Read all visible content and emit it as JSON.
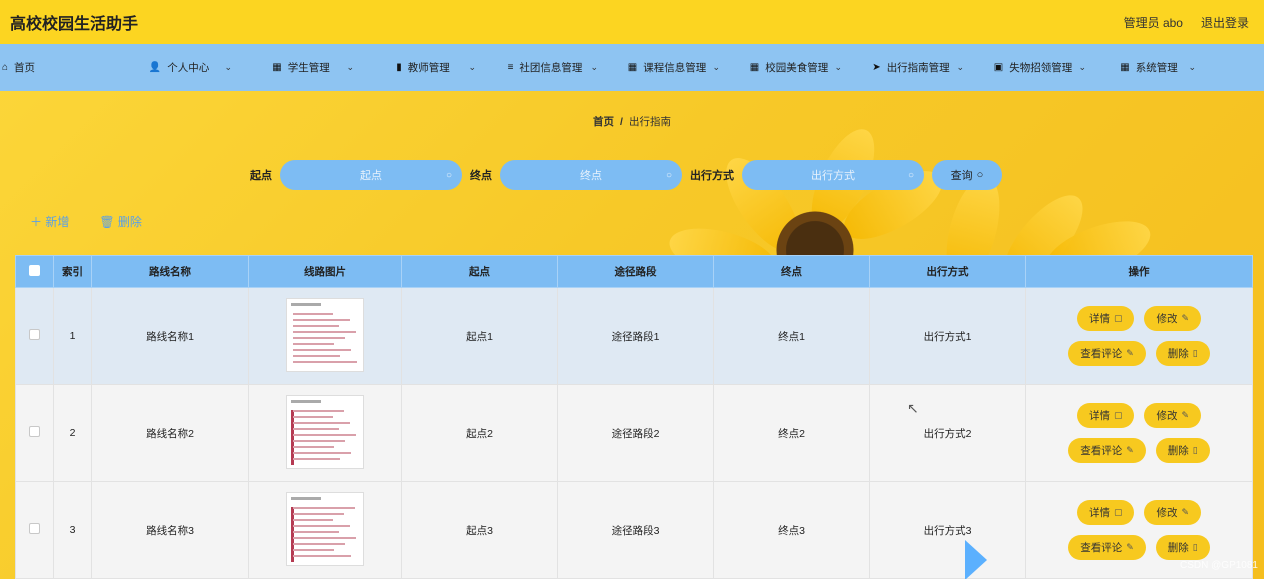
{
  "header": {
    "title": "高校校园生活助手",
    "user": "管理员 abo",
    "logout": "退出登录"
  },
  "nav": [
    {
      "label": "首页",
      "icon": "home-icon",
      "glyph": "⌂",
      "chevron": false
    },
    {
      "label": "个人中心",
      "icon": "user-icon",
      "glyph": "👤",
      "chevron": true
    },
    {
      "label": "学生管理",
      "icon": "grid-icon",
      "glyph": "▦",
      "chevron": true
    },
    {
      "label": "教师管理",
      "icon": "bar-chart-icon",
      "glyph": "▮",
      "chevron": true
    },
    {
      "label": "社团信息管理",
      "icon": "list-icon",
      "glyph": "≡",
      "chevron": true
    },
    {
      "label": "课程信息管理",
      "icon": "grid-icon",
      "glyph": "▦",
      "chevron": true
    },
    {
      "label": "校园美食管理",
      "icon": "grid-icon",
      "glyph": "▦",
      "chevron": true
    },
    {
      "label": "出行指南管理",
      "icon": "send-icon",
      "glyph": "➤",
      "chevron": true
    },
    {
      "label": "失物招领管理",
      "icon": "clipboard-icon",
      "glyph": "▣",
      "chevron": true
    },
    {
      "label": "系统管理",
      "icon": "grid-icon",
      "glyph": "▦",
      "chevron": true
    }
  ],
  "breadcrumb": {
    "home": "首页",
    "sep": "/",
    "current": "出行指南"
  },
  "search": {
    "start_label": "起点",
    "start_placeholder": "起点",
    "end_label": "终点",
    "end_placeholder": "终点",
    "mode_label": "出行方式",
    "mode_placeholder": "出行方式",
    "button": "查询"
  },
  "actions": {
    "add": "＋ 新增",
    "delete": "🗑 删除"
  },
  "table": {
    "columns": [
      "索引",
      "路线名称",
      "线路图片",
      "起点",
      "途径路段",
      "终点",
      "出行方式",
      "操作"
    ],
    "rows": [
      {
        "index": "1",
        "name": "路线名称1",
        "start": "起点1",
        "via": "途径路段1",
        "end": "终点1",
        "mode": "出行方式1"
      },
      {
        "index": "2",
        "name": "路线名称2",
        "start": "起点2",
        "via": "途径路段2",
        "end": "终点2",
        "mode": "出行方式2"
      },
      {
        "index": "3",
        "name": "路线名称3",
        "start": "起点3",
        "via": "途径路段3",
        "end": "终点3",
        "mode": "出行方式3"
      }
    ],
    "ops": {
      "detail": "详情",
      "edit": "修改",
      "comments": "查看评论",
      "delete": "删除"
    }
  },
  "watermark": "CSDN @GP1081",
  "colors": {
    "topbar": "#fcd521",
    "nav": "#8ec4f2",
    "accent_blue": "#7dbcf3",
    "op_button": "#f7c91f"
  }
}
